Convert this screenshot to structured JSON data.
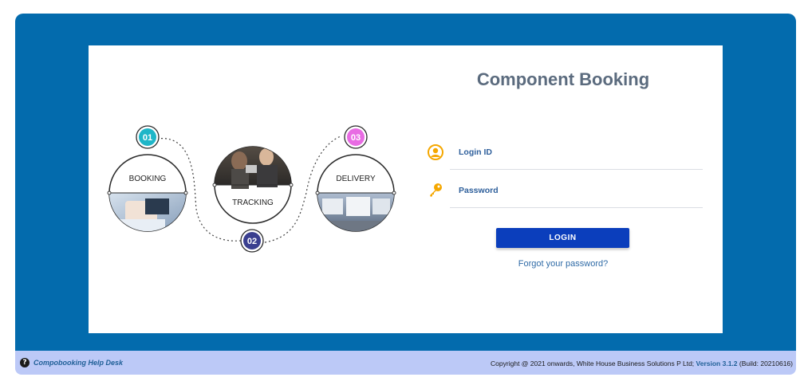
{
  "illustration": {
    "steps": [
      {
        "number": "01",
        "label": "BOOKING",
        "color": "#1fb6c8"
      },
      {
        "number": "02",
        "label": "TRACKING",
        "color": "#3a3f8f"
      },
      {
        "number": "03",
        "label": "DELIVERY",
        "color": "#e86be3"
      }
    ]
  },
  "login": {
    "title": "Component Booking",
    "login_id_label": "Login ID",
    "password_label": "Password",
    "button_label": "LOGIN",
    "forgot_link": "Forgot your password?"
  },
  "footer": {
    "help_icon": "question-circle-icon",
    "help_desk": "Compobooking Help Desk",
    "copyright": "Copyright @ 2021 onwards, White House Business Solutions P Ltd;",
    "version": "Version 3.1.2",
    "build": "(Build: 20210616)"
  },
  "colors": {
    "frame": "#036bad",
    "footer": "#bcc9f7",
    "button": "#0b3ebc",
    "title": "#5b6b7e",
    "label": "#2e5f9b",
    "icon_accent": "#f5a700"
  }
}
